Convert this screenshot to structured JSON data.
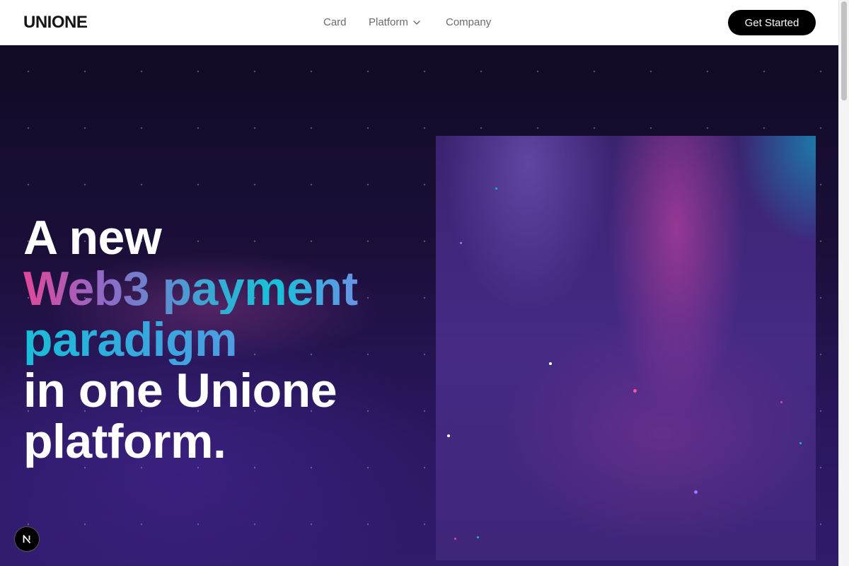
{
  "brand": {
    "logo_text": "UNIONE"
  },
  "nav": {
    "links": [
      {
        "label": "Card"
      },
      {
        "label": "Platform",
        "has_dropdown": true,
        "icon": "chevron-down-icon"
      },
      {
        "label": "Company"
      }
    ],
    "cta_label": "Get Started"
  },
  "hero": {
    "headline_lines": [
      "A new",
      "Web3 payment",
      "paradigm",
      "in one Unione",
      "platform."
    ],
    "gradient_colors": [
      "#e0489a",
      "#8e6ac8",
      "#3ba7d4",
      "#15c3d8",
      "#6a92e6"
    ]
  },
  "badge": {
    "letter": "N",
    "icon": "nextjs-icon"
  },
  "colors": {
    "hero_bg": "#1b0f3a",
    "visual_bg": "#462a85",
    "cta_bg": "#000000",
    "nav_text": "#6b6b6b"
  }
}
